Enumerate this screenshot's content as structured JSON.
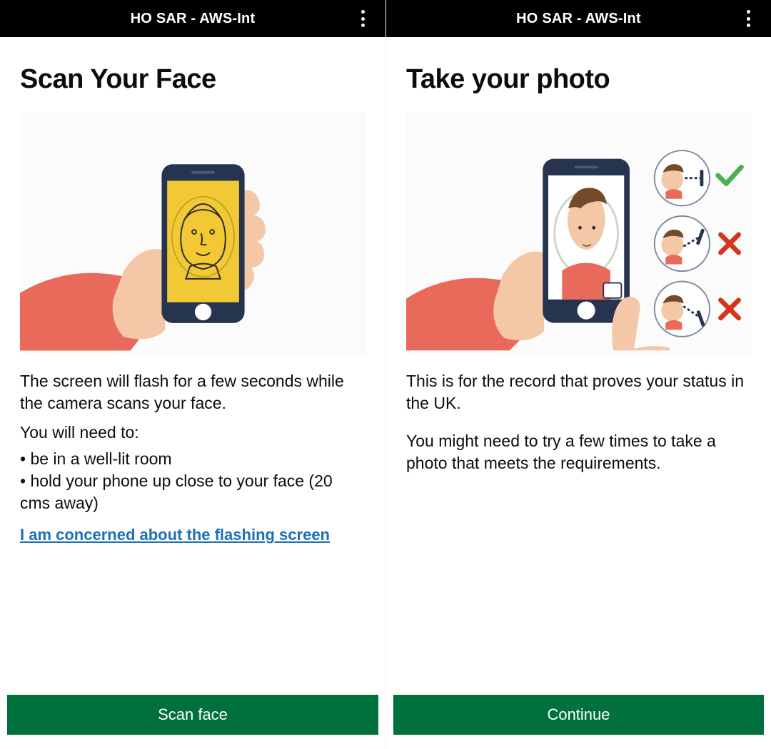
{
  "left": {
    "header": {
      "title": "HO SAR - AWS-Int"
    },
    "heading": "Scan Your Face",
    "para1": "The screen will flash for a few seconds while the camera scans your face.",
    "need_intro": "You will need to:",
    "bullet1": "be in a well-lit room",
    "bullet2": "hold your phone up close to your face (20 cms away)",
    "link": "I am concerned about the flashing screen",
    "cta": "Scan face"
  },
  "right": {
    "header": {
      "title": "HO SAR - AWS-Int"
    },
    "heading": "Take your photo",
    "para1": "This is for the record that proves your status in the UK.",
    "para2": "You might need to try a few times to take a photo that meets the requirements.",
    "cta": "Continue",
    "indicators": [
      {
        "ok": true
      },
      {
        "ok": false
      },
      {
        "ok": false
      }
    ]
  },
  "colors": {
    "cta": "#00703c",
    "link": "#1d70b8",
    "phone": "#27344f",
    "skin": "#f4c7a7",
    "sleeve": "#e96a5b",
    "screen_yellow": "#f2c934",
    "hair": "#734a2a",
    "shirt": "#e96a5b",
    "ok": "#4caf50",
    "bad": "#d4351c"
  }
}
